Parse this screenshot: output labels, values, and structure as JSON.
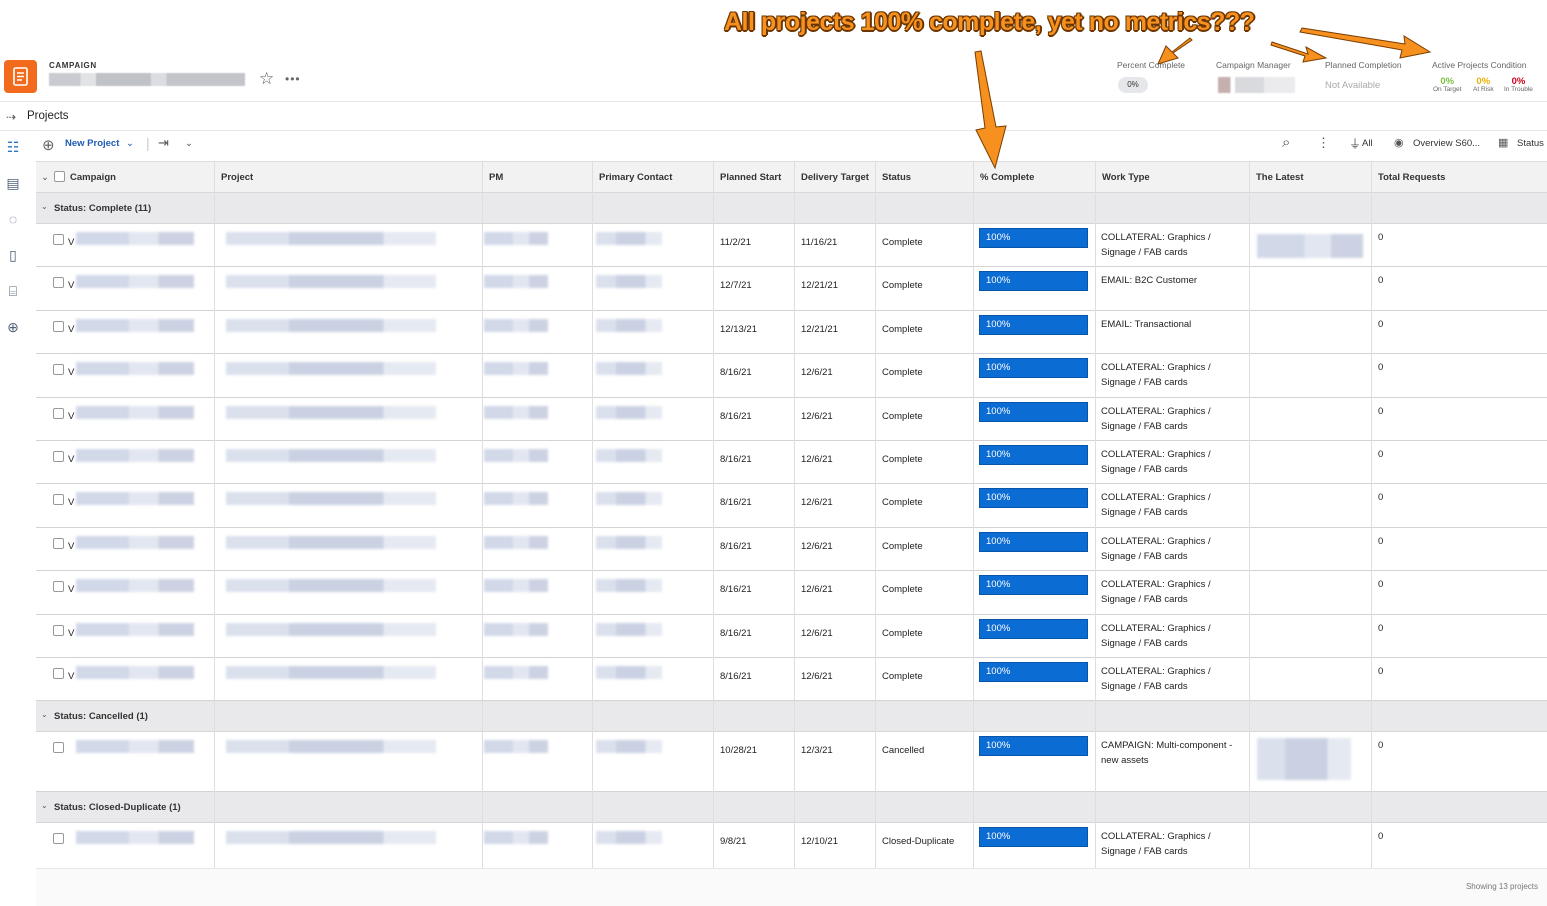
{
  "annotation": {
    "text": "All projects 100% complete, yet no metrics???"
  },
  "header": {
    "object_type": "CAMPAIGN",
    "fields": {
      "percent_complete_label": "Percent Complete",
      "percent_complete_value": "0%",
      "campaign_manager_label": "Campaign Manager",
      "planned_completion_label": "Planned Completion",
      "planned_completion_value": "Not Available",
      "active_condition_label": "Active Projects Condition",
      "on_target_value": "0%",
      "on_target_label": "On Target",
      "at_risk_value": "0%",
      "at_risk_label": "At Risk",
      "in_trouble_value": "0%",
      "in_trouble_label": "In Trouble"
    },
    "condition_colors": {
      "on_target": "#7dc243",
      "at_risk": "#e8b300",
      "in_trouble": "#d0021b"
    }
  },
  "breadcrumb": {
    "label": "Projects"
  },
  "toolbar": {
    "new_project": "New Project",
    "filter_label": "All",
    "view_label": "Overview S60...",
    "grouping_label": "Status"
  },
  "columns": [
    "Campaign",
    "Project",
    "PM",
    "Primary Contact",
    "Planned Start",
    "Delivery Target",
    "Status",
    "% Complete",
    "Work Type",
    "The Latest",
    "Total Requests"
  ],
  "groups": [
    {
      "label": "Status: Complete (11)",
      "rows": [
        {
          "campaign_initial": "V",
          "start": "11/2/21",
          "target": "11/16/21",
          "status": "Complete",
          "pct": "100%",
          "work_type": "COLLATERAL: Graphics / Signage / FAB cards",
          "total": "0"
        },
        {
          "campaign_initial": "V",
          "start": "12/7/21",
          "target": "12/21/21",
          "status": "Complete",
          "pct": "100%",
          "work_type": "EMAIL: B2C Customer",
          "total": "0"
        },
        {
          "campaign_initial": "V",
          "start": "12/13/21",
          "target": "12/21/21",
          "status": "Complete",
          "pct": "100%",
          "work_type": "EMAIL: Transactional",
          "total": "0"
        },
        {
          "campaign_initial": "V",
          "start": "8/16/21",
          "target": "12/6/21",
          "status": "Complete",
          "pct": "100%",
          "work_type": "COLLATERAL: Graphics / Signage / FAB cards",
          "total": "0"
        },
        {
          "campaign_initial": "V",
          "start": "8/16/21",
          "target": "12/6/21",
          "status": "Complete",
          "pct": "100%",
          "work_type": "COLLATERAL: Graphics / Signage / FAB cards",
          "total": "0"
        },
        {
          "campaign_initial": "V",
          "start": "8/16/21",
          "target": "12/6/21",
          "status": "Complete",
          "pct": "100%",
          "work_type": "COLLATERAL: Graphics / Signage / FAB cards",
          "total": "0"
        },
        {
          "campaign_initial": "V",
          "start": "8/16/21",
          "target": "12/6/21",
          "status": "Complete",
          "pct": "100%",
          "work_type": "COLLATERAL: Graphics / Signage / FAB cards",
          "total": "0"
        },
        {
          "campaign_initial": "V",
          "start": "8/16/21",
          "target": "12/6/21",
          "status": "Complete",
          "pct": "100%",
          "work_type": "COLLATERAL: Graphics / Signage / FAB cards",
          "total": "0"
        },
        {
          "campaign_initial": "V",
          "start": "8/16/21",
          "target": "12/6/21",
          "status": "Complete",
          "pct": "100%",
          "work_type": "COLLATERAL: Graphics / Signage / FAB cards",
          "total": "0"
        },
        {
          "campaign_initial": "V",
          "start": "8/16/21",
          "target": "12/6/21",
          "status": "Complete",
          "pct": "100%",
          "work_type": "COLLATERAL: Graphics / Signage / FAB cards",
          "total": "0"
        },
        {
          "campaign_initial": "V",
          "start": "8/16/21",
          "target": "12/6/21",
          "status": "Complete",
          "pct": "100%",
          "work_type": "COLLATERAL: Graphics / Signage / FAB cards",
          "total": "0"
        }
      ]
    },
    {
      "label": "Status: Cancelled (1)",
      "rows": [
        {
          "campaign_initial": "",
          "start": "10/28/21",
          "target": "12/3/21",
          "status": "Cancelled",
          "pct": "100%",
          "work_type": "CAMPAIGN: Multi-component - new assets",
          "total": "0"
        }
      ]
    },
    {
      "label": "Status: Closed-Duplicate (1)",
      "rows": [
        {
          "campaign_initial": "",
          "start": "9/8/21",
          "target": "12/10/21",
          "status": "Closed-Duplicate",
          "pct": "100%",
          "work_type": "COLLATERAL: Graphics / Signage / FAB cards",
          "total": "0"
        }
      ]
    }
  ],
  "footer": {
    "text": "Showing 13 projects"
  }
}
